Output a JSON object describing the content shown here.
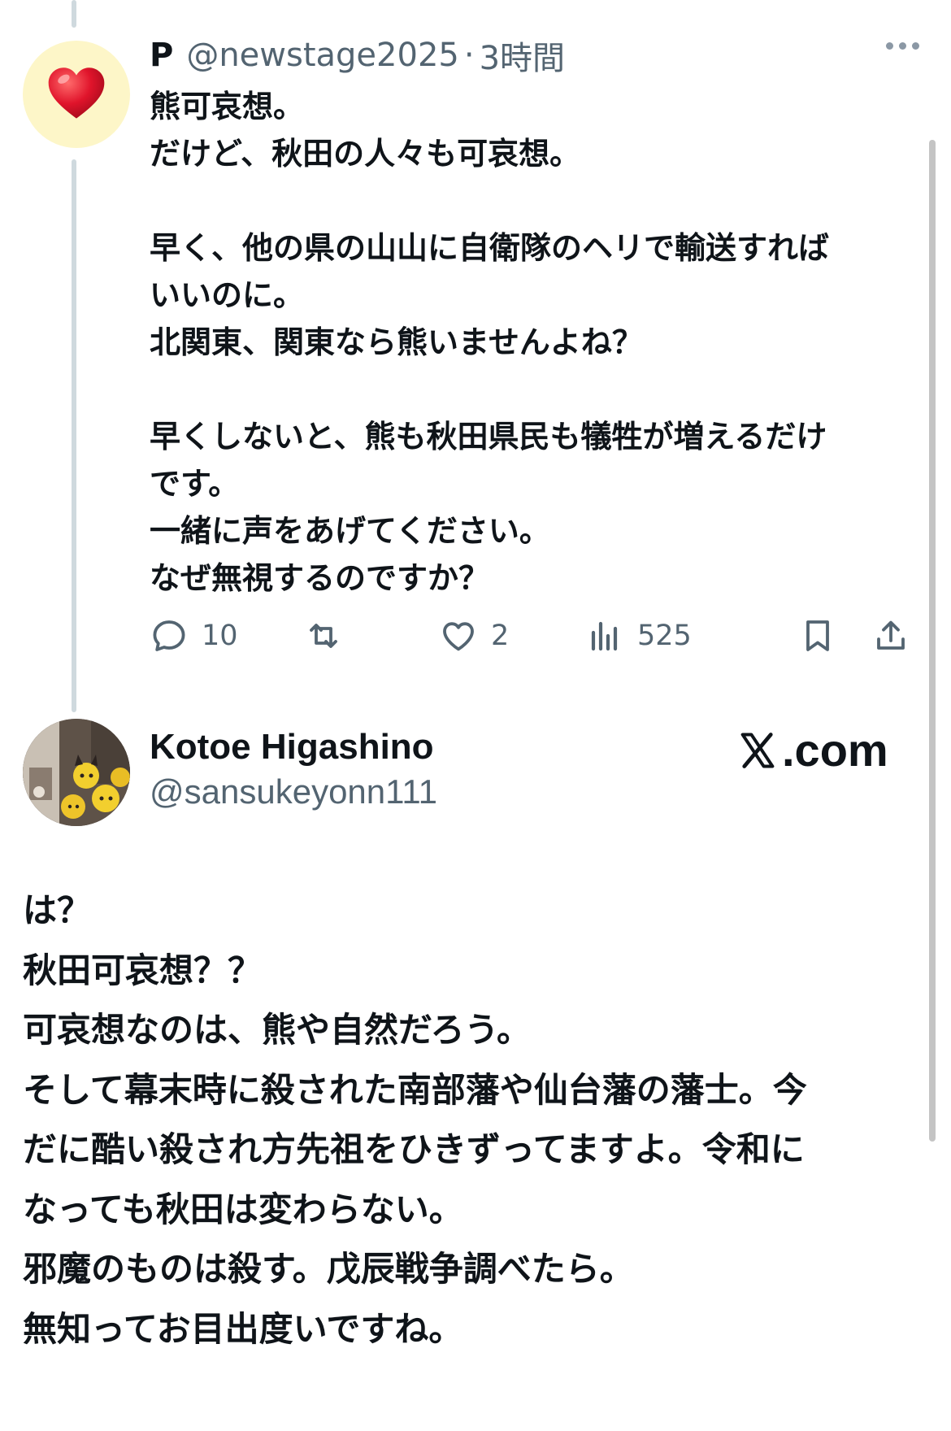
{
  "reply": {
    "avatar_icon": "heart-emoji",
    "name": "P",
    "handle": "@newstage2025",
    "separator": "·",
    "time": "3時間",
    "body": [
      "熊可哀想。",
      "だけど、秋田の人々も可哀想。",
      "",
      "早く、他の県の山山に自衛隊のヘリで輸送すれば",
      "いいのに。",
      "北関東、関東なら熊いませんよね？",
      "",
      "早くしないと、熊も秋田県民も犠牲が増えるだけ",
      "です。",
      "一緒に声をあげてください。",
      "なぜ無視するのですか？"
    ],
    "actions": {
      "replies": "10",
      "retweets": "",
      "likes": "2",
      "views": "525"
    }
  },
  "quoted": {
    "name": "Kotoe Higashino",
    "handle": "@sansukeyonn111",
    "brand": ".com",
    "body": [
      "は？",
      "秋田可哀想？？",
      "可哀想なのは、熊や自然だろう。",
      "そして幕末時に殺された南部藩や仙台藩の藩士。今",
      "だに酷い殺され方先祖をひきずってますよ。令和に",
      "なっても秋田は変わらない。",
      "邪魔のものは殺す。戊辰戦争調べたら。",
      "無知ってお目出度いですね。"
    ]
  },
  "colors": {
    "text": "#0f1419",
    "secondary": "#536471",
    "thread_line": "#cfd9de",
    "heart": "#e0142b",
    "avatar_bg": "#fdf6c8"
  }
}
